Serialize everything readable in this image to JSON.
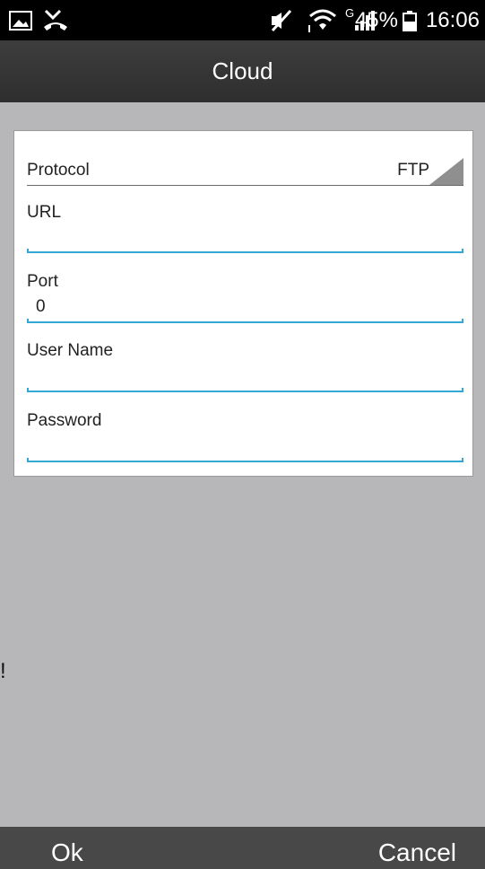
{
  "status_bar": {
    "icons": [
      "gallery-notification-icon",
      "missed-call-icon",
      "mute-icon",
      "wifi-icon",
      "signal-icon",
      "battery-icon"
    ],
    "network_type": "G",
    "battery_percent": "45%",
    "time": "16:06"
  },
  "header": {
    "title": "Cloud"
  },
  "form": {
    "protocol": {
      "label": "Protocol",
      "value": "FTP"
    },
    "url": {
      "label": "URL",
      "value": ""
    },
    "port": {
      "label": "Port",
      "value": "0"
    },
    "username": {
      "label": "User Name",
      "value": ""
    },
    "password": {
      "label": "Password",
      "value": ""
    }
  },
  "stray_text": "!",
  "buttons": {
    "ok": "Ok",
    "cancel": "Cancel"
  },
  "colors": {
    "accent": "#34a8d4",
    "background": "#b7b7b9",
    "title_bar": "#363636",
    "bottom_bar": "#484848"
  }
}
